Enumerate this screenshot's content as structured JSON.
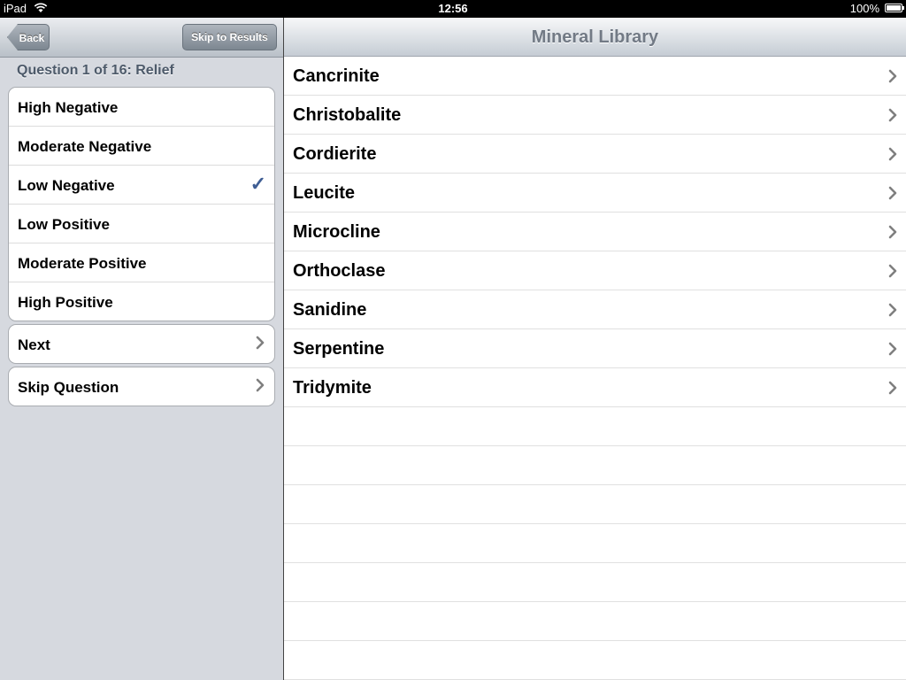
{
  "status_bar": {
    "device": "iPad",
    "time": "12:56",
    "battery": "100%"
  },
  "left_pane": {
    "back_label": "Back",
    "skip_results_label": "Skip to Results",
    "question_header": "Question 1 of 16: Relief",
    "options": [
      {
        "label": "High Negative",
        "selected": false
      },
      {
        "label": "Moderate Negative",
        "selected": false
      },
      {
        "label": "Low Negative",
        "selected": true
      },
      {
        "label": "Low Positive",
        "selected": false
      },
      {
        "label": "Moderate Positive",
        "selected": false
      },
      {
        "label": "High Positive",
        "selected": false
      }
    ],
    "next_label": "Next",
    "skip_question_label": "Skip Question"
  },
  "right_pane": {
    "title": "Mineral Library",
    "minerals": [
      "Cancrinite",
      "Christobalite",
      "Cordierite",
      "Leucite",
      "Microcline",
      "Orthoclase",
      "Sanidine",
      "Serpentine",
      "Tridymite"
    ]
  },
  "colors": {
    "checkmark": "#3f5e94",
    "header_text": "#4d5a6a",
    "title_text": "#727a85"
  }
}
